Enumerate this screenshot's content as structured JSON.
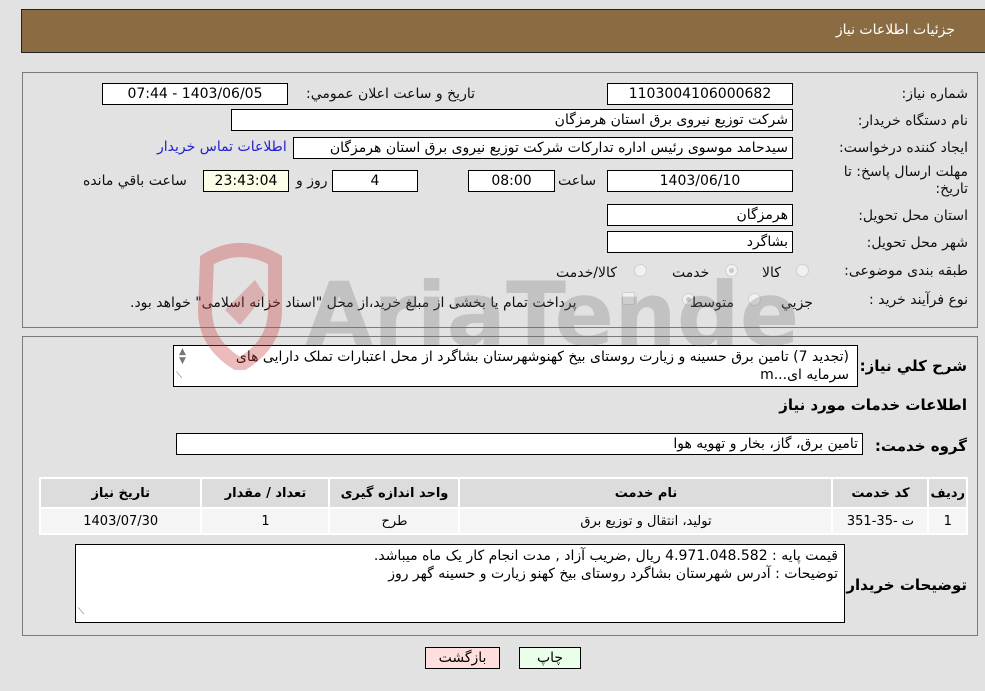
{
  "header": {
    "title": "جزئیات اطلاعات نیاز"
  },
  "form": {
    "need_number": {
      "label": "شماره نیاز:",
      "value": "1103004106000682"
    },
    "announce_datetime": {
      "label": "تاریخ و ساعت اعلان عمومي:",
      "value": "1403/06/05 - 07:44"
    },
    "buyer_org": {
      "label": "نام دستگاه خریدار:",
      "value": "شرکت توزیع نیروی برق استان هرمزگان"
    },
    "requester": {
      "label": "ایجاد کننده درخواست:",
      "value": "سیدحامد موسوی رئیس اداره تدارکات شرکت توزیع نیروی برق استان هرمزگان",
      "contact_link": "اطلاعات تماس خریدار"
    },
    "deadline": {
      "label_line1": "مهلت ارسال پاسخ: تا",
      "label_line2": "تاریخ:",
      "date": "1403/06/10",
      "time_label": "ساعت",
      "time": "08:00",
      "days": "4",
      "days_label": "روز و",
      "remaining": "23:43:04",
      "remaining_label": "ساعت باقي مانده"
    },
    "province": {
      "label": "استان محل تحویل:",
      "value": "هرمزگان"
    },
    "city": {
      "label": "شهر محل تحویل:",
      "value": "بشاگرد"
    },
    "category": {
      "label": "طبقه بندی موضوعی:",
      "options": [
        "کالا",
        "خدمت",
        "کالا/خدمت"
      ],
      "selected": "خدمت"
    },
    "process": {
      "label": "نوع فرآیند خرید :",
      "options": [
        "جزیي",
        "متوسط"
      ],
      "selected": "متوسط",
      "treasury_note": "پرداخت تمام یا بخشی از مبلغ خرید،از محل \"اسناد خزانه اسلامی\" خواهد بود."
    }
  },
  "summary": {
    "label": "شرح كلي نیاز:",
    "value": "(تجدید 7) تامین برق حسینه و زیارت روستای بیخ کهنوشهرستان بشاگرد از محل اعتبارات تملک دارایی های سرمایه ای...m"
  },
  "services": {
    "section_title": "اطلاعات خدمات مورد نیاز",
    "group_label": "گروه خدمت:",
    "group_value": "تامین برق، گاز، بخار و تهویه هوا",
    "columns": [
      "ردیف",
      "کد خدمت",
      "نام خدمت",
      "واحد اندازه گیری",
      "تعداد / مقدار",
      "تاریخ نیاز"
    ],
    "rows": [
      [
        "1",
        "ت -35-351",
        "تولید، انتقال و توزیع برق",
        "طرح",
        "1",
        "1403/07/30"
      ]
    ]
  },
  "buyer_notes": {
    "label": "توضیحات خریدار:",
    "line1": "قیمت پایه : 4.971.048.582  ریال ,ضریب آزاد , مدت انجام کار یک ماه میباشد.",
    "line2": "توضیحات : آدرس شهرستان  بشاگرد روستای بیخ کهنو زیارت و حسینه گهر روز"
  },
  "buttons": {
    "print": "چاپ",
    "back": "بازگشت"
  },
  "colors": {
    "header_bg": "#8b6c42",
    "print_bg": "#eaffea",
    "back_bg": "#ffdede",
    "link": "#2222cc"
  },
  "watermark": {
    "text": "AriaTender.neT"
  }
}
